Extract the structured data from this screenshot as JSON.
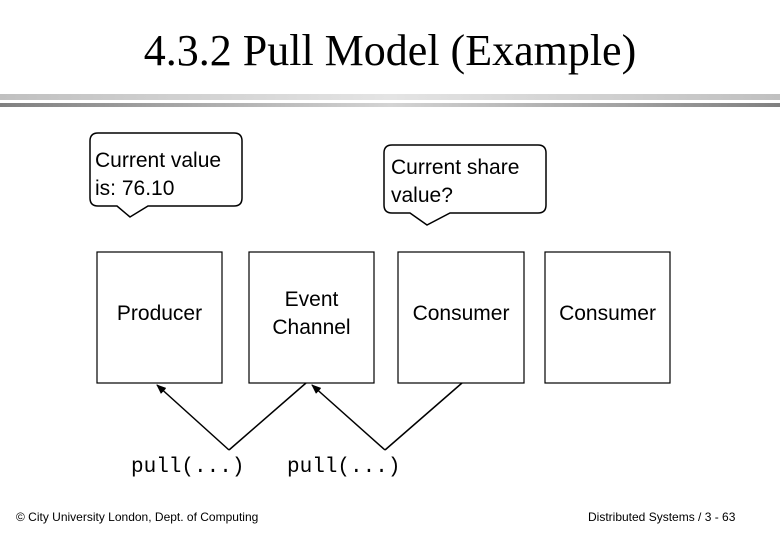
{
  "slide": {
    "title": "4.3.2 Pull Model (Example)",
    "callouts": [
      {
        "id": "producer-callout",
        "text": "Current value\nis: 76.10"
      },
      {
        "id": "consumer-callout",
        "text": "Current share\nvalue?"
      }
    ],
    "boxes": [
      {
        "id": "producer",
        "label": "Producer"
      },
      {
        "id": "event-channel",
        "label": "Event\nChannel"
      },
      {
        "id": "consumer-1",
        "label": "Consumer"
      },
      {
        "id": "consumer-2",
        "label": "Consumer"
      }
    ],
    "operations": [
      {
        "label": "pull(...)",
        "from": "event-channel",
        "to": "producer"
      },
      {
        "label": "pull(...)",
        "from": "consumer-1",
        "to": "event-channel"
      }
    ],
    "footer": {
      "left": "© City University London, Dept. of Computing",
      "right": "Distributed Systems / 3 - 63"
    }
  }
}
